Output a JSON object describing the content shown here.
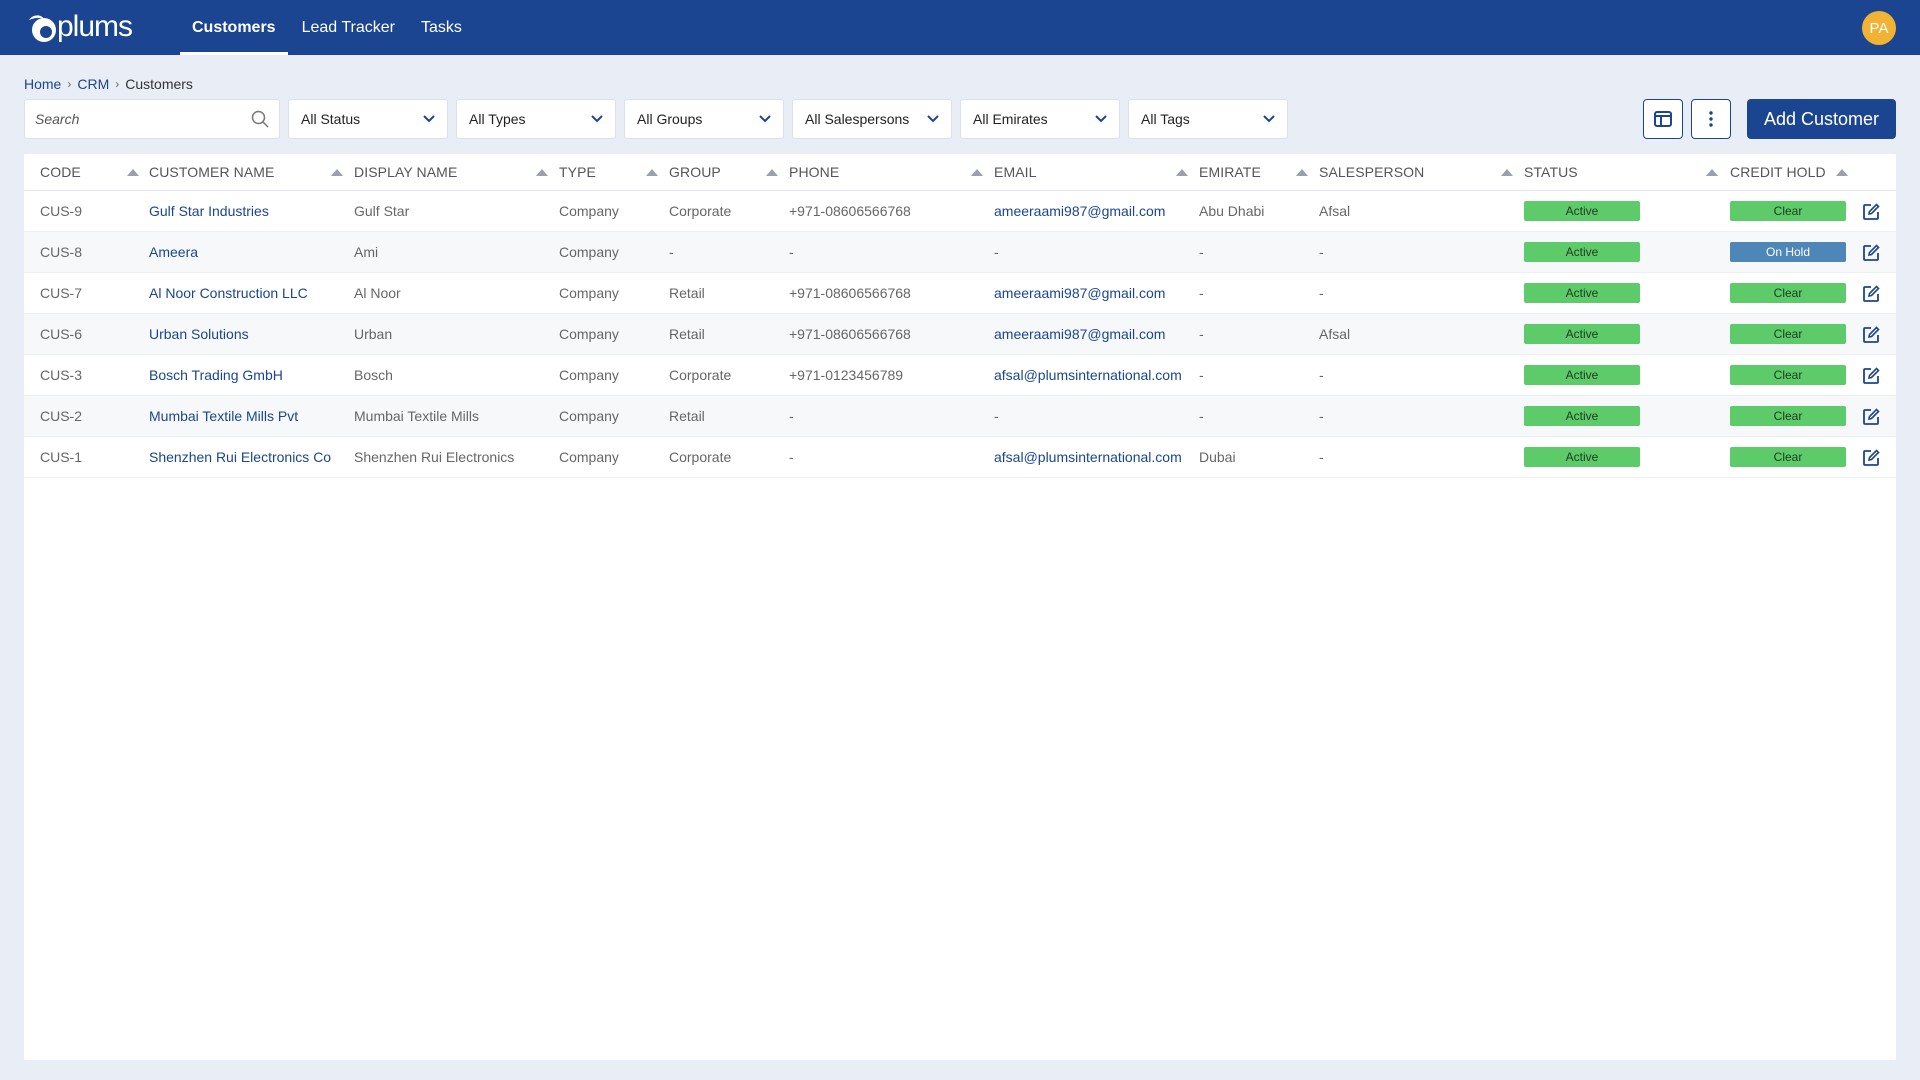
{
  "app": {
    "logo_text": "plums",
    "avatar_initials": "PA"
  },
  "nav": [
    {
      "label": "Customers",
      "active": true
    },
    {
      "label": "Lead Tracker",
      "active": false
    },
    {
      "label": "Tasks",
      "active": false
    }
  ],
  "breadcrumb": {
    "home": "Home",
    "crm": "CRM",
    "current": "Customers"
  },
  "filters": {
    "search_placeholder": "Search",
    "status": "All Status",
    "types": "All Types",
    "groups": "All Groups",
    "salespersons": "All Salespersons",
    "emirates": "All Emirates",
    "tags": "All Tags"
  },
  "toolbar": {
    "add_label": "Add Customer",
    "columns_icon": "columns-icon",
    "more_icon": "more-vertical-icon"
  },
  "table": {
    "headers": {
      "code": "CODE",
      "customer_name": "CUSTOMER NAME",
      "display_name": "DISPLAY NAME",
      "type": "TYPE",
      "group": "GROUP",
      "phone": "PHONE",
      "email": "EMAIL",
      "emirate": "EMIRATE",
      "salesperson": "SALESPERSON",
      "status": "STATUS",
      "credit_hold": "CREDIT HOLD"
    },
    "rows": [
      {
        "code": "CUS-9",
        "customer_name": "Gulf Star Industries",
        "display_name": "Gulf Star",
        "type": "Company",
        "group": "Corporate",
        "phone": "+971-08606566768",
        "email": "ameeraami987@gmail.com",
        "emirate": "Abu Dhabi",
        "salesperson": "Afsal",
        "status": "Active",
        "credit_hold": "Clear"
      },
      {
        "code": "CUS-8",
        "customer_name": "Ameera",
        "display_name": "Ami",
        "type": "Company",
        "group": "-",
        "phone": "-",
        "email": "-",
        "emirate": "-",
        "salesperson": "-",
        "status": "Active",
        "credit_hold": "On Hold"
      },
      {
        "code": "CUS-7",
        "customer_name": "Al Noor Construction LLC",
        "display_name": "Al Noor",
        "type": "Company",
        "group": "Retail",
        "phone": "+971-08606566768",
        "email": "ameeraami987@gmail.com",
        "emirate": "-",
        "salesperson": "-",
        "status": "Active",
        "credit_hold": "Clear"
      },
      {
        "code": "CUS-6",
        "customer_name": "Urban Solutions",
        "display_name": "Urban",
        "type": "Company",
        "group": "Retail",
        "phone": "+971-08606566768",
        "email": "ameeraami987@gmail.com",
        "emirate": "-",
        "salesperson": "Afsal",
        "status": "Active",
        "credit_hold": "Clear"
      },
      {
        "code": "CUS-3",
        "customer_name": "Bosch Trading GmbH",
        "display_name": "Bosch",
        "type": "Company",
        "group": "Corporate",
        "phone": "+971-0123456789",
        "email": "afsal@plumsinternational.com",
        "emirate": "-",
        "salesperson": "-",
        "status": "Active",
        "credit_hold": "Clear"
      },
      {
        "code": "CUS-2",
        "customer_name": "Mumbai Textile Mills Pvt",
        "display_name": "Mumbai Textile Mills",
        "type": "Company",
        "group": "Retail",
        "phone": "-",
        "email": "-",
        "emirate": "-",
        "salesperson": "-",
        "status": "Active",
        "credit_hold": "Clear"
      },
      {
        "code": "CUS-1",
        "customer_name": "Shenzhen Rui Electronics Co",
        "display_name": "Shenzhen Rui Electronics",
        "type": "Company",
        "group": "Corporate",
        "phone": "-",
        "email": "afsal@plumsinternational.com",
        "emirate": "Dubai",
        "salesperson": "-",
        "status": "Active",
        "credit_hold": "Clear"
      }
    ]
  },
  "colors": {
    "primary": "#1b4590",
    "active_pill": "#5dcb6a",
    "on_hold_pill": "#4f86b8",
    "avatar": "#f0b334"
  }
}
